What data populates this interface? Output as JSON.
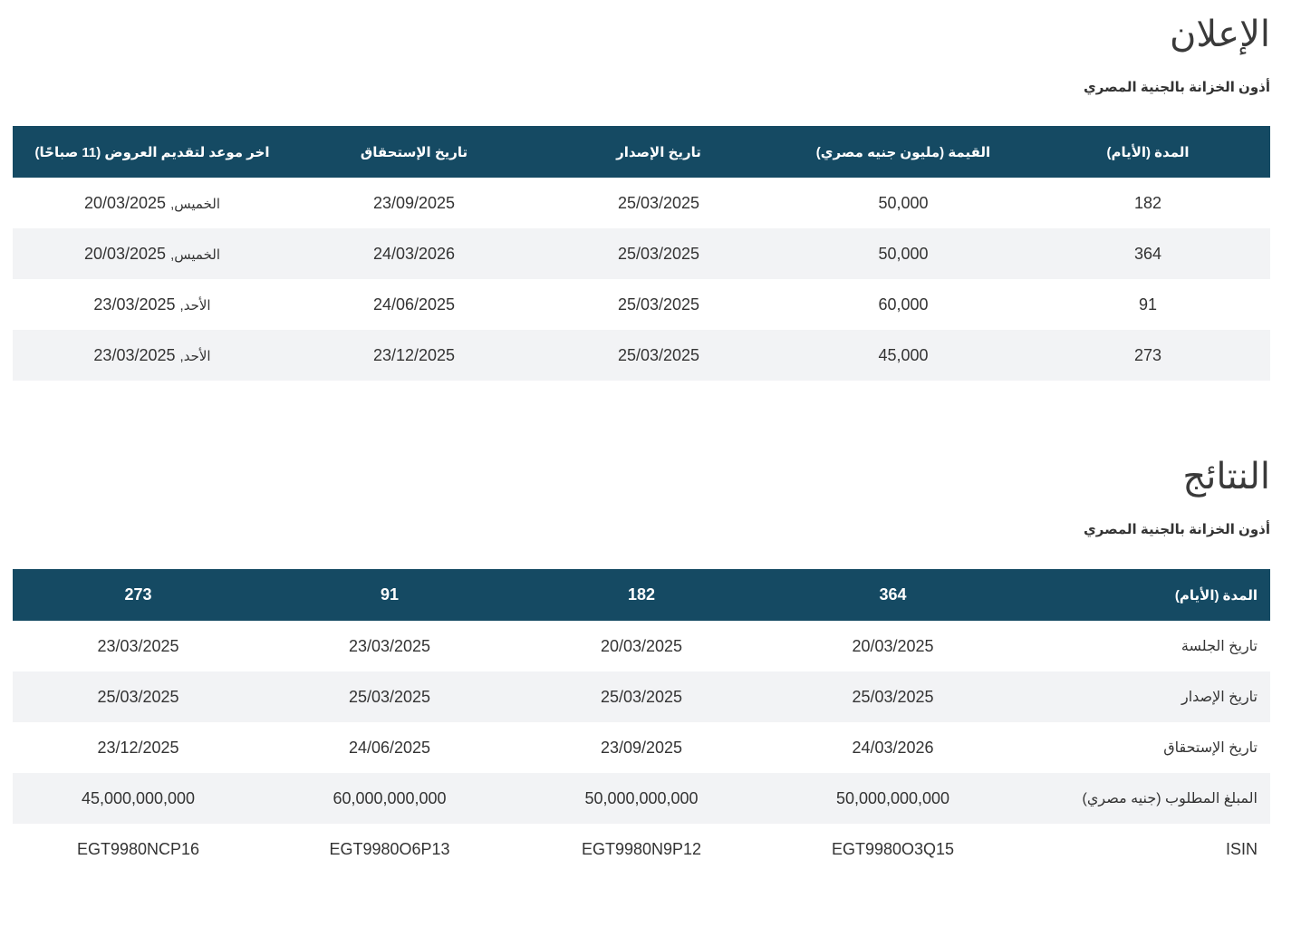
{
  "announcement": {
    "title": "الإعلان",
    "subtitle": "أذون الخزانة بالجنية المصري",
    "headers": {
      "duration": "المدة (الأيام)",
      "value": "القيمة (مليون جنيه مصري)",
      "issue_date": "تاريخ الإصدار",
      "maturity_date": "تاريخ الإستحقاق",
      "deadline": "اخر موعد لتقديم العروض (11 صباحًا)"
    },
    "rows": [
      {
        "duration": "182",
        "value": "50,000",
        "issue_date": "25/03/2025",
        "maturity_date": "23/09/2025",
        "deadline_day": "الخميس,",
        "deadline_date": "20/03/2025"
      },
      {
        "duration": "364",
        "value": "50,000",
        "issue_date": "25/03/2025",
        "maturity_date": "24/03/2026",
        "deadline_day": "الخميس,",
        "deadline_date": "20/03/2025"
      },
      {
        "duration": "91",
        "value": "60,000",
        "issue_date": "25/03/2025",
        "maturity_date": "24/06/2025",
        "deadline_day": "الأحد,",
        "deadline_date": "23/03/2025"
      },
      {
        "duration": "273",
        "value": "45,000",
        "issue_date": "25/03/2025",
        "maturity_date": "23/12/2025",
        "deadline_day": "الأحد,",
        "deadline_date": "23/03/2025"
      }
    ]
  },
  "results": {
    "title": "النتائج",
    "subtitle": "أذون الخزانة بالجنية المصري",
    "header_label": "المدة (الأيام)",
    "durations": [
      "364",
      "182",
      "91",
      "273"
    ],
    "rows": [
      {
        "label": "تاريخ الجلسة",
        "values": [
          "20/03/2025",
          "20/03/2025",
          "23/03/2025",
          "23/03/2025"
        ]
      },
      {
        "label": "تاريخ الإصدار",
        "values": [
          "25/03/2025",
          "25/03/2025",
          "25/03/2025",
          "25/03/2025"
        ]
      },
      {
        "label": "تاريخ الإستحقاق",
        "values": [
          "24/03/2026",
          "23/09/2025",
          "24/06/2025",
          "23/12/2025"
        ]
      },
      {
        "label": "المبلغ المطلوب (جنيه مصري)",
        "values": [
          "50,000,000,000",
          "50,000,000,000",
          "60,000,000,000",
          "45,000,000,000"
        ]
      },
      {
        "label": "ISIN",
        "values": [
          "EGT9980O3Q15",
          "EGT9980N9P12",
          "EGT9980O6P13",
          "EGT9980NCP16"
        ]
      }
    ]
  }
}
